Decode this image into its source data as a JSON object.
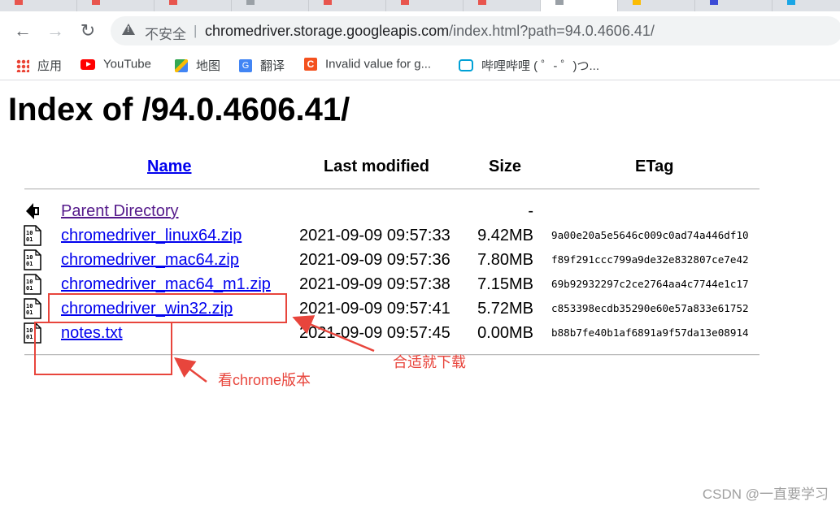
{
  "browser": {
    "address": {
      "security_label": "不安全",
      "separator": "|",
      "host": "chromedriver.storage.googleapis.com",
      "path": "/index.html?path=94.0.4606.41/"
    },
    "bookmarks": [
      {
        "label": "应用",
        "icon": "apps-grid-icon"
      },
      {
        "label": "YouTube",
        "icon": "youtube-icon"
      },
      {
        "label": "地图",
        "icon": "maps-icon"
      },
      {
        "label": "翻译",
        "icon": "translate-icon"
      },
      {
        "label": "Invalid value for g...",
        "icon": "csdn-icon"
      },
      {
        "label": "哔哩哔哩 ( ゜- ゜)つ...",
        "icon": "bilibili-icon"
      }
    ]
  },
  "page": {
    "title": "Index of /94.0.4606.41/",
    "columns": {
      "name": "Name",
      "modified": "Last modified",
      "size": "Size",
      "etag": "ETag"
    },
    "parent": {
      "name": "Parent Directory",
      "size": "-"
    },
    "files": [
      {
        "name": "chromedriver_linux64.zip",
        "modified": "2021-09-09 09:57:33",
        "size": "9.42MB",
        "etag": "9a00e20a5e5646c009c0ad74a446df10"
      },
      {
        "name": "chromedriver_mac64.zip",
        "modified": "2021-09-09 09:57:36",
        "size": "7.80MB",
        "etag": "f89f291ccc799a9de32e832807ce7e42"
      },
      {
        "name": "chromedriver_mac64_m1.zip",
        "modified": "2021-09-09 09:57:38",
        "size": "7.15MB",
        "etag": "69b92932297c2ce2764aa4c7744e1c17"
      },
      {
        "name": "chromedriver_win32.zip",
        "modified": "2021-09-09 09:57:41",
        "size": "5.72MB",
        "etag": "c853398ecdb35290e60e57a833e61752"
      },
      {
        "name": "notes.txt",
        "modified": "2021-09-09 09:57:45",
        "size": "0.00MB",
        "etag": "b88b7fe40b1af6891a9f57da13e08914"
      }
    ]
  },
  "annotations": {
    "download_note": "合适就下载",
    "version_note": "看chrome版本",
    "color": "#e8453c"
  },
  "watermark": "CSDN @一直要学习"
}
